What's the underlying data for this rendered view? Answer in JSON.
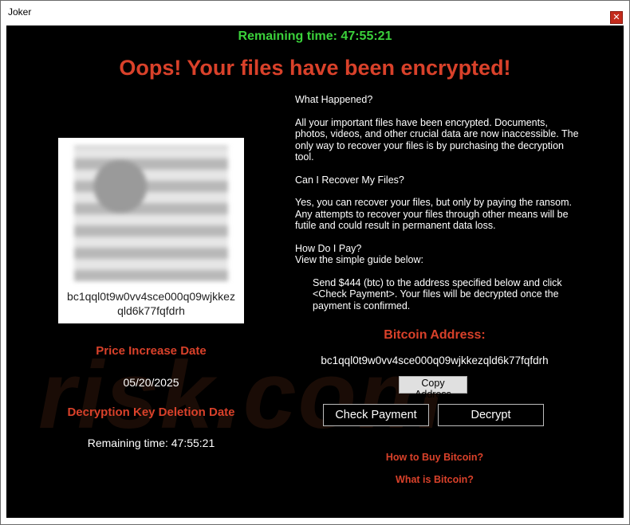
{
  "window": {
    "title": "Joker",
    "close_glyph": "✕"
  },
  "timer_top": "Remaining time: 47:55:21",
  "headline": "Oops! Your files have been encrypted!",
  "qr": {
    "address": "bc1qql0t9w0vv4sce000q09wjkkezqld6k77fqfdrh"
  },
  "left": {
    "price_increase_label": "Price Increase Date",
    "price_increase_date": "05/20/2025",
    "deletion_label": "Decryption Key Deletion Date",
    "deletion_remaining": "Remaining time: 47:55:21"
  },
  "info": {
    "q1": "What Happened?",
    "a1": "All your important files have been encrypted. Documents, photos, videos, and other crucial data are now inaccessible. The only way to recover your files is by purchasing the decryption tool.",
    "q2": "Can I Recover My Files?",
    "a2": "Yes, you can recover your files, but only by paying the ransom. Any attempts to recover your files through other means will be futile and could result in permanent data loss.",
    "q3": "How Do I Pay?",
    "q3_sub": "View the simple guide below:",
    "a3": "Send $444 (btc) to the address specified below and click <Check Payment>. Your files will be decrypted once the payment is confirmed."
  },
  "bitcoin": {
    "title": "Bitcoin Address:",
    "address": "bc1qql0t9w0vv4sce000q09wjkkezqld6k77fqfdrh",
    "copy_label": "Copy Address"
  },
  "buttons": {
    "check_payment": "Check Payment",
    "decrypt": "Decrypt"
  },
  "links": {
    "how_to_buy": "How to Buy Bitcoin?",
    "what_is": "What is Bitcoin?"
  },
  "watermark": "risk.com",
  "colors": {
    "accent_red": "#d9412a",
    "timer_green": "#3bd13b",
    "background": "#000000"
  }
}
